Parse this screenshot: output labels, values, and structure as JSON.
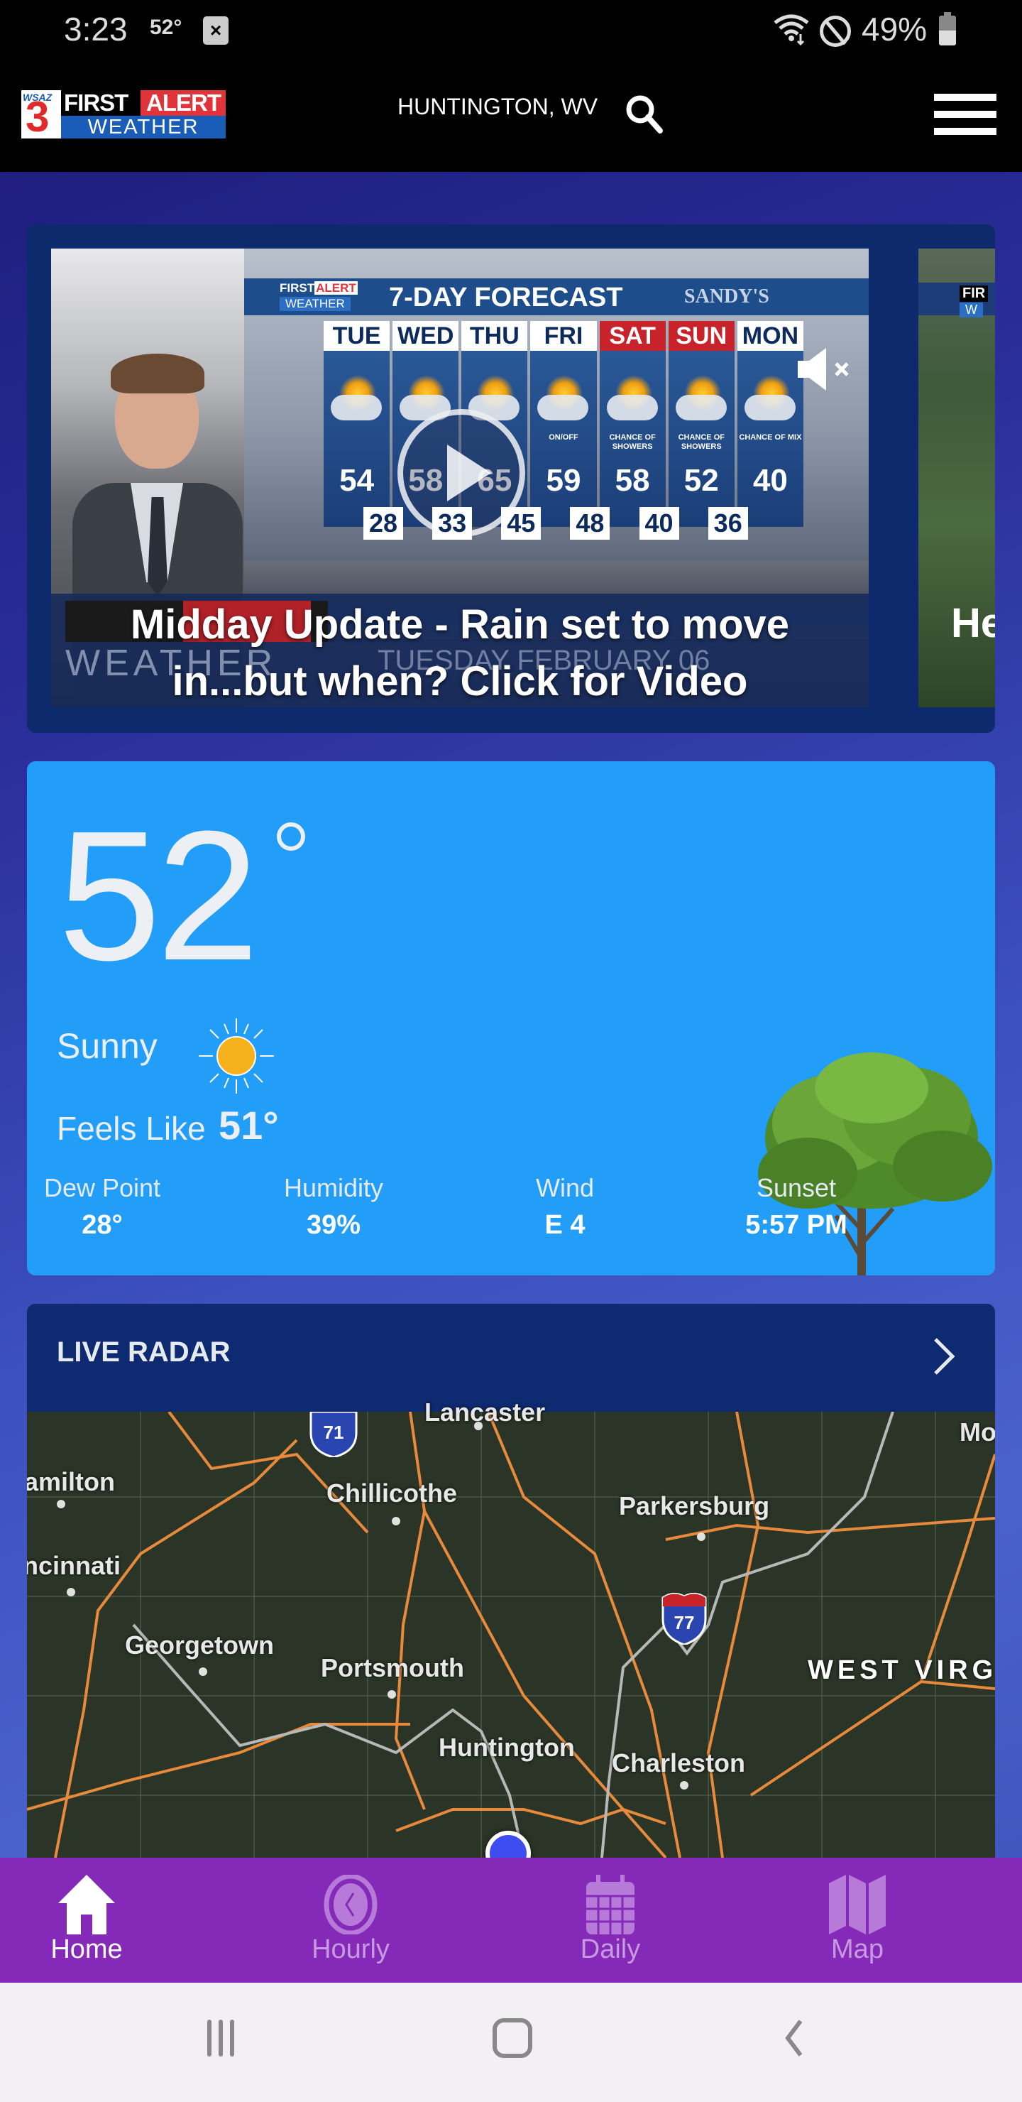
{
  "status_bar": {
    "time": "3:23",
    "temp": "52°",
    "notification_icon": "close-box-icon",
    "battery_text": "49%",
    "battery_level": 0.49
  },
  "header": {
    "logo": {
      "station": "WSAZ",
      "channel": "3",
      "first": "FIRST",
      "alert": "ALERT",
      "weather": "WEATHER"
    },
    "location": "HUNTINGTON, WV",
    "search_icon": "search-icon",
    "menu_icon": "hamburger-menu-icon"
  },
  "video_carousel": {
    "slides": [
      {
        "caption": "Midday Update - Rain set to move in...but when? Click for Video",
        "board": {
          "brand_first": "FIRST",
          "brand_alert": "ALERT",
          "brand_weather": "WEATHER",
          "title": "7-DAY FORECAST",
          "sponsor": "SANDY'S",
          "days": [
            {
              "day": "TUE",
              "hi": "54",
              "lo": "28",
              "desc": "",
              "weekend": false
            },
            {
              "day": "WED",
              "hi": "58",
              "lo": "33",
              "desc": "",
              "weekend": false
            },
            {
              "day": "THU",
              "hi": "65",
              "lo": "45",
              "desc": "",
              "weekend": false
            },
            {
              "day": "FRI",
              "hi": "59",
              "lo": "48",
              "desc": "ON/OFF",
              "weekend": false
            },
            {
              "day": "SAT",
              "hi": "58",
              "lo": "40",
              "desc": "CHANCE OF SHOWERS",
              "weekend": true
            },
            {
              "day": "SUN",
              "hi": "52",
              "lo": "36",
              "desc": "CHANCE OF SHOWERS",
              "weekend": true
            },
            {
              "day": "MON",
              "hi": "40",
              "lo": "",
              "desc": "CHANCE OF MIX",
              "weekend": false
            }
          ],
          "lower_third_weather": "WEATHER",
          "lower_third_date": "TUESDAY FEBRUARY 06"
        }
      },
      {
        "caption": "He",
        "banner_first": "FIR",
        "banner_weather": "W"
      }
    ],
    "play_icon": "play-icon",
    "mute_icon": "volume-mute-icon"
  },
  "current": {
    "temp": "52",
    "condition": "Sunny",
    "condition_icon": "sun-icon",
    "feels_like_label": "Feels Like",
    "feels_like_value": "51°",
    "stats": [
      {
        "label": "Dew Point",
        "value": "28°"
      },
      {
        "label": "Humidity",
        "value": "39%"
      },
      {
        "label": "Wind",
        "value": "E 4"
      },
      {
        "label": "Sunset",
        "value": "5:57 PM"
      }
    ]
  },
  "radar": {
    "title": "LIVE RADAR",
    "cities": [
      {
        "name": "Lancaster"
      },
      {
        "name": "amilton"
      },
      {
        "name": "Chillicothe"
      },
      {
        "name": "Parkersburg"
      },
      {
        "name": "ncinnati"
      },
      {
        "name": "Georgetown"
      },
      {
        "name": "Portsmouth"
      },
      {
        "name": "Huntington"
      },
      {
        "name": "Charleston"
      },
      {
        "name": "Mo"
      }
    ],
    "state_label": "WEST VIRGINIA",
    "interstates": [
      "71",
      "77"
    ]
  },
  "bottom_nav": {
    "items": [
      {
        "label": "Home",
        "icon": "home-icon",
        "active": true
      },
      {
        "label": "Hourly",
        "icon": "clock-icon",
        "active": false
      },
      {
        "label": "Daily",
        "icon": "calendar-icon",
        "active": false
      },
      {
        "label": "Map",
        "icon": "map-icon",
        "active": false
      }
    ]
  },
  "system_nav": {
    "recent": "recent-apps-icon",
    "home": "home-button-icon",
    "back": "back-icon"
  }
}
